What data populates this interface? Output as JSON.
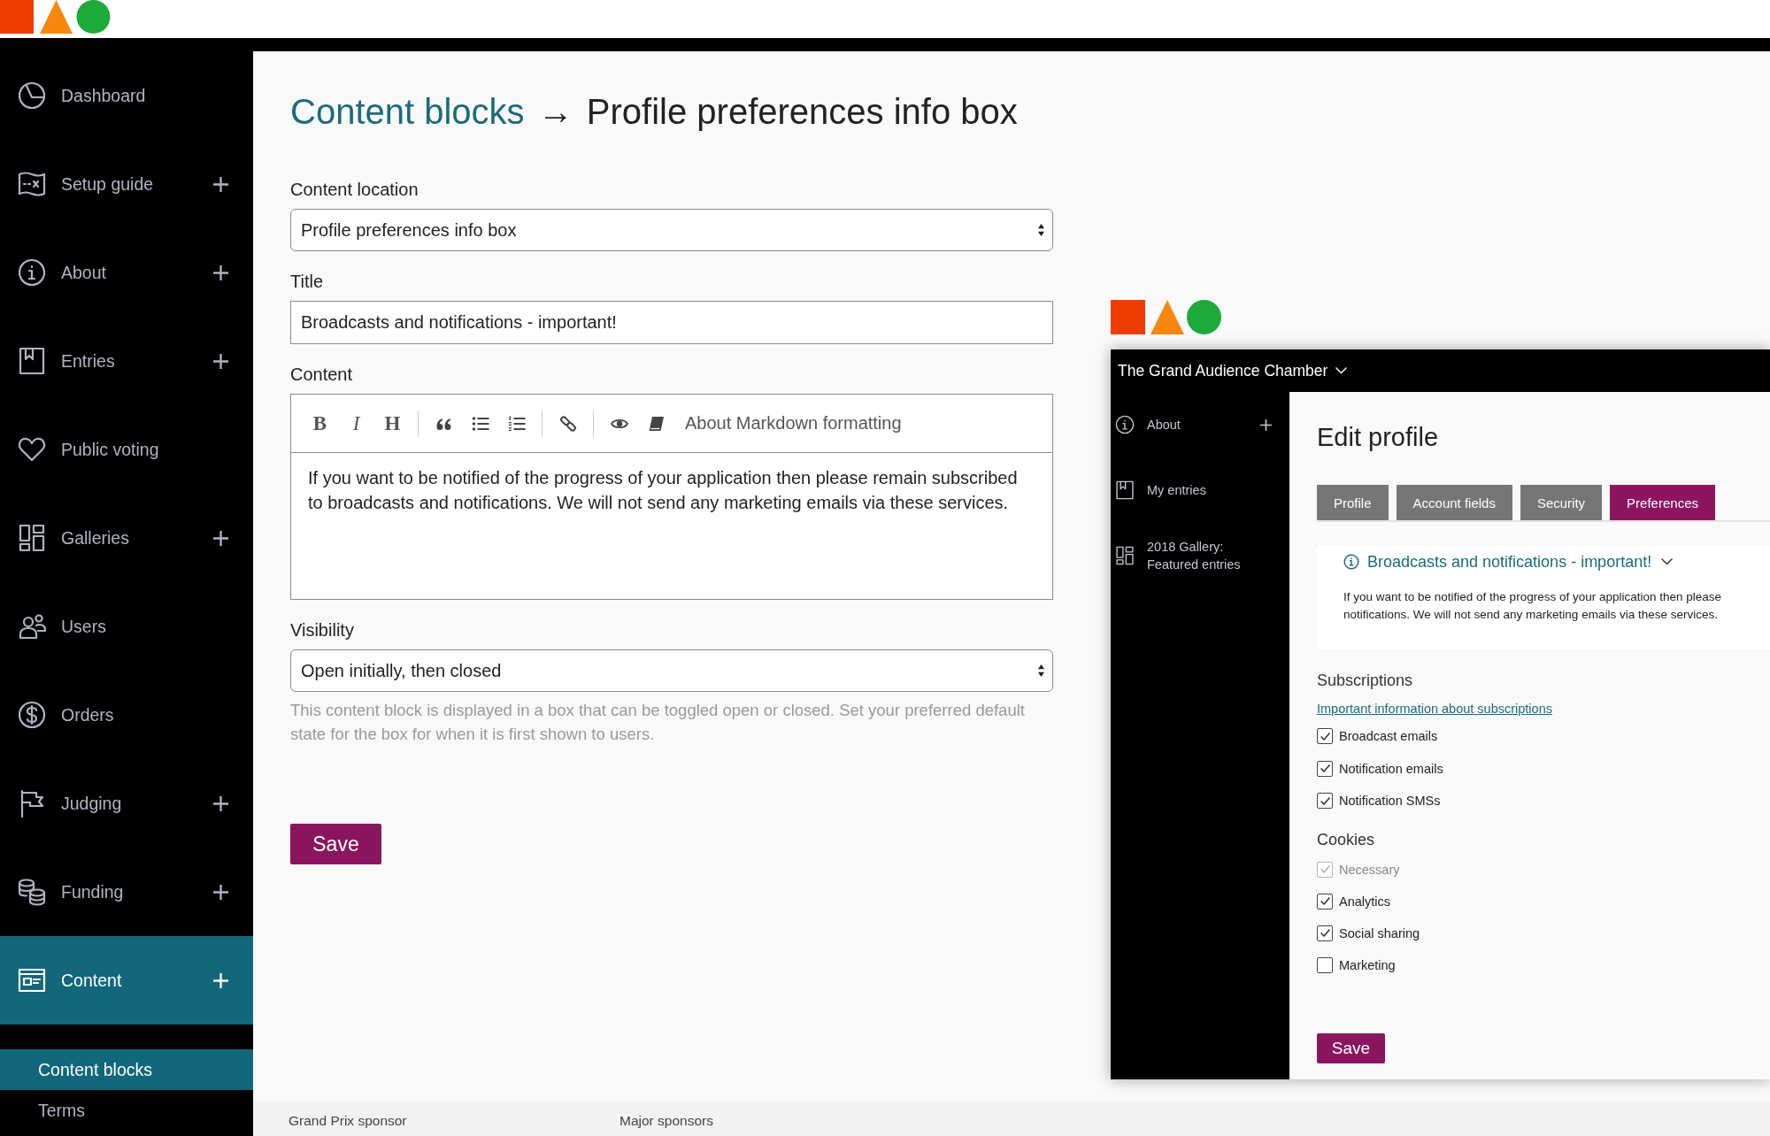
{
  "sidebar": {
    "items": [
      {
        "label": "Dashboard",
        "expandable": false,
        "selected": false
      },
      {
        "label": "Setup guide",
        "expandable": true,
        "selected": false
      },
      {
        "label": "About",
        "expandable": true,
        "selected": false
      },
      {
        "label": "Entries",
        "expandable": true,
        "selected": false
      },
      {
        "label": "Public voting",
        "expandable": false,
        "selected": false
      },
      {
        "label": "Galleries",
        "expandable": true,
        "selected": false
      },
      {
        "label": "Users",
        "expandable": false,
        "selected": false
      },
      {
        "label": "Orders",
        "expandable": false,
        "selected": false
      },
      {
        "label": "Judging",
        "expandable": true,
        "selected": false
      },
      {
        "label": "Funding",
        "expandable": true,
        "selected": false
      },
      {
        "label": "Content",
        "expandable": true,
        "selected": true,
        "children": [
          {
            "label": "Content blocks",
            "selected": true
          },
          {
            "label": "Terms",
            "selected": false
          }
        ]
      }
    ]
  },
  "page": {
    "breadcrumb": {
      "parent": "Content blocks",
      "separator": "→",
      "title": "Profile preferences info box"
    },
    "fields": [
      {
        "kind": "select",
        "label": "Content location",
        "value": "Profile preferences info box"
      },
      {
        "kind": "text",
        "label": "Title",
        "value": "Broadcasts and notifications - important!"
      },
      {
        "kind": "editor",
        "label": "Content",
        "format_buttons": [
          "B",
          "I",
          "H"
        ],
        "help_link": "About Markdown formatting",
        "value": "If you want to be notified of the progress of your application then please remain subscribed to broadcasts and notifications. We will not send any marketing emails via these services."
      },
      {
        "kind": "select",
        "label": "Visibility",
        "value": "Open initially, then closed",
        "help": "This content block is displayed in a box that can be toggled open or closed. Set your preferred default state for the box for when it is first shown to users."
      }
    ],
    "save_button": "Save"
  },
  "preview": {
    "site_title": "The Grand Audience Chamber",
    "sidebar": [
      {
        "label": "About",
        "expandable": true
      },
      {
        "label": "My entries",
        "expandable": false
      },
      {
        "label": "2018 Gallery: Featured entries",
        "expandable": false
      }
    ],
    "heading": "Edit profile",
    "tabs": [
      {
        "label": "Profile",
        "selected": false
      },
      {
        "label": "Account fields",
        "selected": false
      },
      {
        "label": "Security",
        "selected": false
      },
      {
        "label": "Preferences",
        "selected": true
      }
    ],
    "info_box": {
      "title": "Broadcasts and notifications - important!",
      "expanded": true,
      "body_lines": [
        "If you want to be notified of the progress of your application then please",
        "notifications. We will not send any marketing emails via these services."
      ]
    },
    "sections": [
      {
        "heading": "Subscriptions",
        "link": "Important information about subscriptions",
        "options": [
          {
            "label": "Broadcast emails",
            "checked": true,
            "disabled": false
          },
          {
            "label": "Notification emails",
            "checked": true,
            "disabled": false
          },
          {
            "label": "Notification SMSs",
            "checked": true,
            "disabled": false
          }
        ]
      },
      {
        "heading": "Cookies",
        "options": [
          {
            "label": "Necessary",
            "checked": true,
            "disabled": true
          },
          {
            "label": "Analytics",
            "checked": true,
            "disabled": false
          },
          {
            "label": "Social sharing",
            "checked": true,
            "disabled": false
          },
          {
            "label": "Marketing",
            "checked": false,
            "disabled": false
          }
        ]
      }
    ],
    "save_button": "Save"
  },
  "footer": {
    "columns": [
      "Grand Prix sponsor",
      "Major sponsors"
    ]
  }
}
